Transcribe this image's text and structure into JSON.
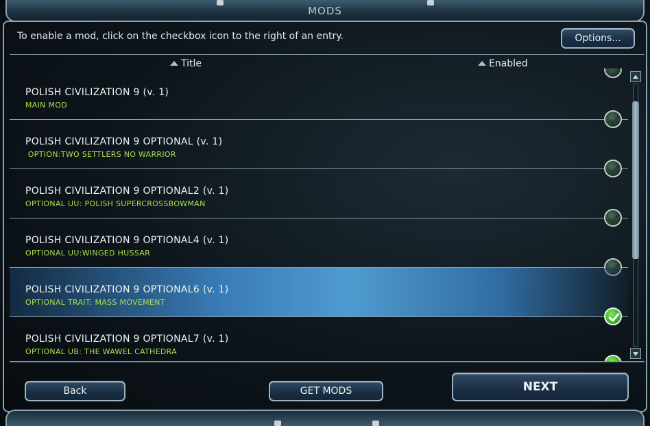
{
  "window": {
    "title": "MODS"
  },
  "instructions": "To enable a mod, click on the checkbox icon to the right of an entry.",
  "options_label": "Options...",
  "columns": {
    "title": "Title",
    "enabled": "Enabled"
  },
  "mods": [
    {
      "title": "POLISH CIVILIZATION 9 (v. 1)",
      "subtitle": "MAIN MOD",
      "enabled": false,
      "selected": false
    },
    {
      "title": "POLISH CIVILIZATION 9 OPTIONAL (v. 1)",
      "subtitle": " OPTION:TWO SETTLERS NO WARRIOR",
      "enabled": false,
      "selected": false
    },
    {
      "title": "POLISH CIVILIZATION 9 OPTIONAL2 (v. 1)",
      "subtitle": "OPTIONAL UU: POLISH SUPERCROSSBOWMAN",
      "enabled": false,
      "selected": false
    },
    {
      "title": "POLISH CIVILIZATION 9 OPTIONAL4 (v. 1)",
      "subtitle": "OPTIONAL UU:WINGED HUSSAR",
      "enabled": false,
      "selected": false
    },
    {
      "title": "POLISH CIVILIZATION 9 OPTIONAL6 (v. 1)",
      "subtitle": "OPTIONAL TRAIT: MASS MOVEMENT",
      "enabled": true,
      "selected": true
    },
    {
      "title": "POLISH CIVILIZATION 9 OPTIONAL7 (v. 1)",
      "subtitle": "OPTIONAL UB: THE WAWEL CATHEDRA",
      "enabled": true,
      "selected": false
    }
  ],
  "buttons": {
    "back": "Back",
    "get_mods": "GET MODS",
    "next": "NEXT"
  },
  "colors": {
    "subtitle": "#a8e04a",
    "selected_row": "#3a7db8",
    "check_on": "#4fc12f"
  },
  "scroll": {
    "position_fraction": 0.25
  }
}
